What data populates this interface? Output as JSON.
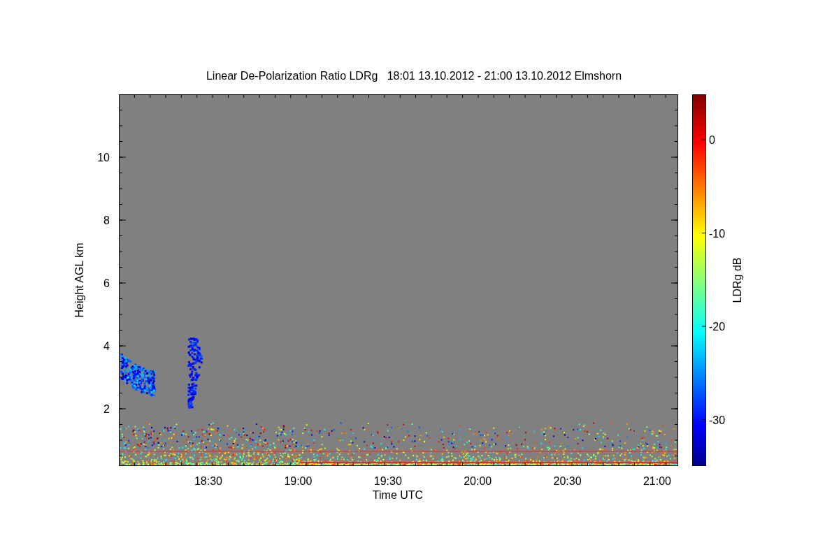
{
  "plot": {
    "title": "Linear De-Polarization Ratio LDRg   18:01 13.10.2012 - 21:00 13.10.2012 Elmshorn",
    "x_axis": {
      "label": "Time UTC",
      "ticks": [
        "18:30",
        "19:00",
        "19:30",
        "20:00",
        "20:30",
        "21:00"
      ]
    },
    "y_axis": {
      "label": "Height AGL km",
      "ticks": [
        "10",
        "8",
        "6",
        "4",
        "2"
      ]
    }
  },
  "colorbar": {
    "label": "LDRg dB",
    "ticks": [
      "0",
      "-10",
      "-20",
      "-30"
    ]
  }
}
